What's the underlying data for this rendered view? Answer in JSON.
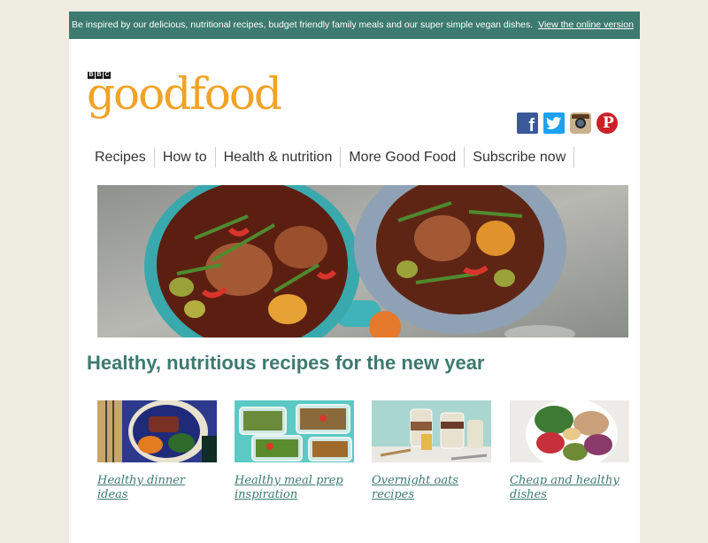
{
  "top_bar": {
    "text": "Be inspired by our delicious, nutritional recipes, budget friendly family meals and our super simple vegan dishes.",
    "online_link": "View the online version"
  },
  "logo": {
    "bbc": [
      "B",
      "B",
      "C"
    ],
    "wordmark": "goodfood"
  },
  "social": [
    {
      "name": "facebook-icon"
    },
    {
      "name": "twitter-icon"
    },
    {
      "name": "instagram-icon"
    },
    {
      "name": "pinterest-icon"
    }
  ],
  "nav": [
    "Recipes",
    "How to",
    "Health & nutrition",
    "More Good Food",
    "Subscribe now"
  ],
  "headline": "Healthy, nutritious recipes for the new year",
  "cards": [
    {
      "title": "Healthy dinner ideas"
    },
    {
      "title": "Healthy meal prep inspiration"
    },
    {
      "title": "Overnight oats recipes"
    },
    {
      "title": "Cheap and healthy dishes"
    }
  ],
  "colors": {
    "accent": "#3d7a70",
    "brand": "#f0a326",
    "background": "#efece2"
  }
}
